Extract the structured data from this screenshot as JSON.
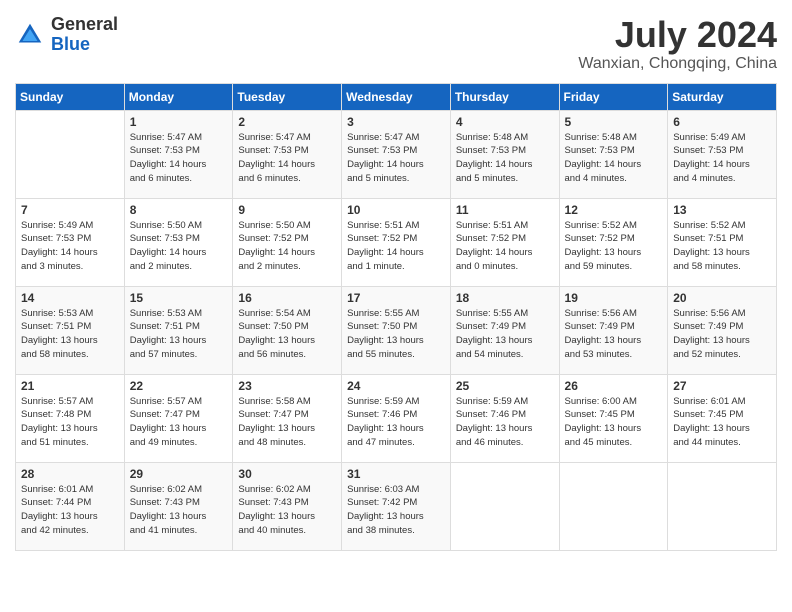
{
  "logo": {
    "general": "General",
    "blue": "Blue"
  },
  "title": {
    "month_year": "July 2024",
    "location": "Wanxian, Chongqing, China"
  },
  "days_of_week": [
    "Sunday",
    "Monday",
    "Tuesday",
    "Wednesday",
    "Thursday",
    "Friday",
    "Saturday"
  ],
  "weeks": [
    [
      {
        "day": "",
        "info": ""
      },
      {
        "day": "1",
        "info": "Sunrise: 5:47 AM\nSunset: 7:53 PM\nDaylight: 14 hours\nand 6 minutes."
      },
      {
        "day": "2",
        "info": "Sunrise: 5:47 AM\nSunset: 7:53 PM\nDaylight: 14 hours\nand 6 minutes."
      },
      {
        "day": "3",
        "info": "Sunrise: 5:47 AM\nSunset: 7:53 PM\nDaylight: 14 hours\nand 5 minutes."
      },
      {
        "day": "4",
        "info": "Sunrise: 5:48 AM\nSunset: 7:53 PM\nDaylight: 14 hours\nand 5 minutes."
      },
      {
        "day": "5",
        "info": "Sunrise: 5:48 AM\nSunset: 7:53 PM\nDaylight: 14 hours\nand 4 minutes."
      },
      {
        "day": "6",
        "info": "Sunrise: 5:49 AM\nSunset: 7:53 PM\nDaylight: 14 hours\nand 4 minutes."
      }
    ],
    [
      {
        "day": "7",
        "info": "Sunrise: 5:49 AM\nSunset: 7:53 PM\nDaylight: 14 hours\nand 3 minutes."
      },
      {
        "day": "8",
        "info": "Sunrise: 5:50 AM\nSunset: 7:53 PM\nDaylight: 14 hours\nand 2 minutes."
      },
      {
        "day": "9",
        "info": "Sunrise: 5:50 AM\nSunset: 7:52 PM\nDaylight: 14 hours\nand 2 minutes."
      },
      {
        "day": "10",
        "info": "Sunrise: 5:51 AM\nSunset: 7:52 PM\nDaylight: 14 hours\nand 1 minute."
      },
      {
        "day": "11",
        "info": "Sunrise: 5:51 AM\nSunset: 7:52 PM\nDaylight: 14 hours\nand 0 minutes."
      },
      {
        "day": "12",
        "info": "Sunrise: 5:52 AM\nSunset: 7:52 PM\nDaylight: 13 hours\nand 59 minutes."
      },
      {
        "day": "13",
        "info": "Sunrise: 5:52 AM\nSunset: 7:51 PM\nDaylight: 13 hours\nand 58 minutes."
      }
    ],
    [
      {
        "day": "14",
        "info": "Sunrise: 5:53 AM\nSunset: 7:51 PM\nDaylight: 13 hours\nand 58 minutes."
      },
      {
        "day": "15",
        "info": "Sunrise: 5:53 AM\nSunset: 7:51 PM\nDaylight: 13 hours\nand 57 minutes."
      },
      {
        "day": "16",
        "info": "Sunrise: 5:54 AM\nSunset: 7:50 PM\nDaylight: 13 hours\nand 56 minutes."
      },
      {
        "day": "17",
        "info": "Sunrise: 5:55 AM\nSunset: 7:50 PM\nDaylight: 13 hours\nand 55 minutes."
      },
      {
        "day": "18",
        "info": "Sunrise: 5:55 AM\nSunset: 7:49 PM\nDaylight: 13 hours\nand 54 minutes."
      },
      {
        "day": "19",
        "info": "Sunrise: 5:56 AM\nSunset: 7:49 PM\nDaylight: 13 hours\nand 53 minutes."
      },
      {
        "day": "20",
        "info": "Sunrise: 5:56 AM\nSunset: 7:49 PM\nDaylight: 13 hours\nand 52 minutes."
      }
    ],
    [
      {
        "day": "21",
        "info": "Sunrise: 5:57 AM\nSunset: 7:48 PM\nDaylight: 13 hours\nand 51 minutes."
      },
      {
        "day": "22",
        "info": "Sunrise: 5:57 AM\nSunset: 7:47 PM\nDaylight: 13 hours\nand 49 minutes."
      },
      {
        "day": "23",
        "info": "Sunrise: 5:58 AM\nSunset: 7:47 PM\nDaylight: 13 hours\nand 48 minutes."
      },
      {
        "day": "24",
        "info": "Sunrise: 5:59 AM\nSunset: 7:46 PM\nDaylight: 13 hours\nand 47 minutes."
      },
      {
        "day": "25",
        "info": "Sunrise: 5:59 AM\nSunset: 7:46 PM\nDaylight: 13 hours\nand 46 minutes."
      },
      {
        "day": "26",
        "info": "Sunrise: 6:00 AM\nSunset: 7:45 PM\nDaylight: 13 hours\nand 45 minutes."
      },
      {
        "day": "27",
        "info": "Sunrise: 6:01 AM\nSunset: 7:45 PM\nDaylight: 13 hours\nand 44 minutes."
      }
    ],
    [
      {
        "day": "28",
        "info": "Sunrise: 6:01 AM\nSunset: 7:44 PM\nDaylight: 13 hours\nand 42 minutes."
      },
      {
        "day": "29",
        "info": "Sunrise: 6:02 AM\nSunset: 7:43 PM\nDaylight: 13 hours\nand 41 minutes."
      },
      {
        "day": "30",
        "info": "Sunrise: 6:02 AM\nSunset: 7:43 PM\nDaylight: 13 hours\nand 40 minutes."
      },
      {
        "day": "31",
        "info": "Sunrise: 6:03 AM\nSunset: 7:42 PM\nDaylight: 13 hours\nand 38 minutes."
      },
      {
        "day": "",
        "info": ""
      },
      {
        "day": "",
        "info": ""
      },
      {
        "day": "",
        "info": ""
      }
    ]
  ]
}
